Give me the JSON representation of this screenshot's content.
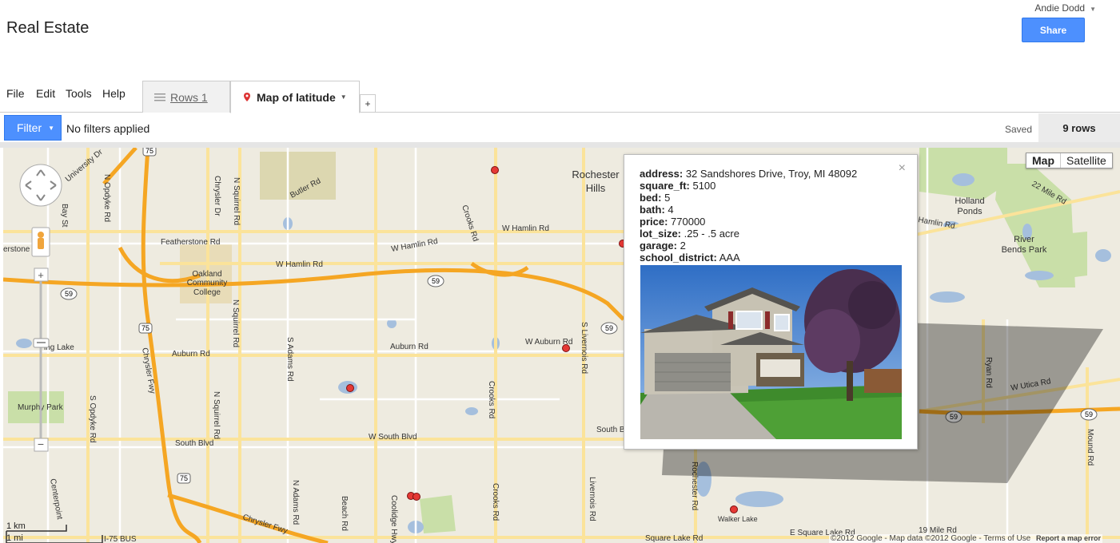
{
  "app": {
    "title": "Real Estate",
    "user": "Andie Dodd",
    "share_label": "Share"
  },
  "menu": [
    "File",
    "Edit",
    "Tools",
    "Help"
  ],
  "tabs": {
    "rows_label": "Rows 1",
    "map_label": "Map of latitude",
    "add_label": "+"
  },
  "filterbar": {
    "filter_label": "Filter",
    "status": "No filters applied",
    "saved": "Saved",
    "row_count": "9 rows"
  },
  "map": {
    "type_map": "Map",
    "type_satellite": "Satellite",
    "labels": {
      "rochester_hills": "Rochester",
      "rochester_hills2": "Hills",
      "holland": "Holland",
      "holland2": "Ponds",
      "river": "River",
      "river2": "Bends Park",
      "oakland": "Oakland",
      "oakland2": "Community",
      "oakland3": "College",
      "murphy": "Murphy Park",
      "walker": "Walker Lake",
      "featherstone": "Featherstone Rd",
      "w_hamlin": "W Hamlin Rd",
      "w_hamlin2": "W Hamlin Rd",
      "hamlin_rd": "Hamlin Rd",
      "butler": "Butler Rd",
      "auburn": "Auburn Rd",
      "auburn2": "Auburn Rd",
      "w_auburn": "W Auburn Rd",
      "south_blvd": "South Blvd",
      "w_south_blvd": "W South Blvd",
      "e_square_lake": "E Square Lake Rd",
      "square_lake": "Square Lake Rd",
      "w_utica": "W Utica Rd",
      "mile22": "22 Mile Rd",
      "mile19": "19 Mile Rd",
      "chrysler_fwy": "Chrysler Fwy",
      "chrysler_fwy2": "Chrysler Fwy",
      "crooks": "Crooks Rd",
      "crooks2": "Crooks Rd",
      "crooks3": "Crooks Rd",
      "livernois": "S Livernois Rd",
      "livernois2": "Livernois Rd",
      "rochester_rd": "Rochester Rd",
      "ryan": "Ryan Rd",
      "mound": "Mound Rd",
      "coolidge": "Coolidge Hwy",
      "beach": "Beach Rd",
      "n_adams": "N Adams Rd",
      "s_adams": "S Adams Rd",
      "n_squirrel": "N Squirrel Rd",
      "n_squirrel2": "N Squirrel Rd",
      "n_squirrel3": "N Squirrel Rd",
      "s_opdyke": "S Opdyke Rd",
      "n_opdyke": "N Opdyke Rd",
      "bay_st": "Bay St",
      "university": "University Dr",
      "chrysler_dr": "Chrysler Dr",
      "centerpoint": "Centerpoint",
      "i75bus": "I-75 BUS",
      "estone": "erstone S",
      "ing_lake": "ing Lake",
      "south_blvd_left": "South Blvd",
      "shield_75": "75",
      "shield_59": "59"
    },
    "scale_km": "1 km",
    "scale_mi": "1 mi",
    "copyright": "©2012 Google - Map data ©2012 Google - Terms of Use",
    "report": "Report a map error"
  },
  "info_window": {
    "close": "×",
    "fields": [
      {
        "key": "address:",
        "value": " 32 Sandshores Drive, Troy, MI 48092"
      },
      {
        "key": "square_ft:",
        "value": " 5100"
      },
      {
        "key": "bed:",
        "value": " 5"
      },
      {
        "key": "bath:",
        "value": " 4"
      },
      {
        "key": "price:",
        "value": " 770000"
      },
      {
        "key": "lot_size:",
        "value": " .25 - .5 acre"
      },
      {
        "key": "garage:",
        "value": " 2"
      },
      {
        "key": "school_district:",
        "value": " AAA"
      }
    ]
  }
}
